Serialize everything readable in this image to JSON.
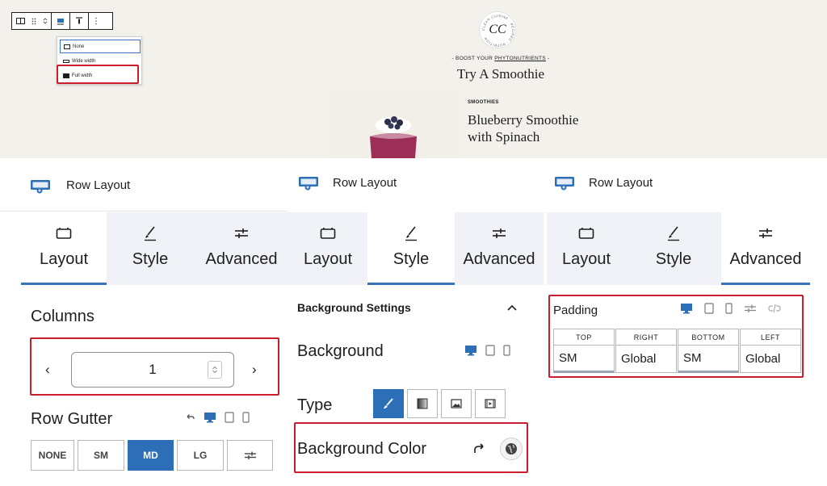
{
  "preview": {
    "align_menu": {
      "items": [
        {
          "label": "None"
        },
        {
          "label": "Wide width"
        },
        {
          "label": "Full width"
        }
      ]
    },
    "logo_text": "CC",
    "logo_ring_text": "CLEAN CUISINE · RECIPES · NUTRITION",
    "boost_prefix": "- BOOST YOUR ",
    "boost_link": "PHYTONUTRIENTS",
    "boost_suffix": " -",
    "section_title": "Try A Smoothie",
    "recipe_category": "SMOOTHIES",
    "recipe_name": "Blueberry Smoothie with Spinach"
  },
  "panels": [
    {
      "block_title": "Row Layout",
      "tabs": [
        {
          "label": "Layout",
          "icon": "layout-icon",
          "active": true
        },
        {
          "label": "Style",
          "icon": "brush-icon",
          "active": false
        },
        {
          "label": "Advanced",
          "icon": "sliders-icon",
          "active": false
        }
      ],
      "columns_label": "Columns",
      "columns_value": "1",
      "prev_glyph": "‹",
      "next_glyph": "›",
      "gutter_label": "Row Gutter",
      "gutter_options": [
        "NONE",
        "SM",
        "MD",
        "LG"
      ],
      "gutter_selected": "MD"
    },
    {
      "block_title": "Row Layout",
      "tabs": [
        {
          "label": "Layout",
          "icon": "layout-icon",
          "active": false
        },
        {
          "label": "Style",
          "icon": "brush-icon",
          "active": true
        },
        {
          "label": "Advanced",
          "icon": "sliders-icon",
          "active": false
        }
      ],
      "bg_settings_label": "Background Settings",
      "background_label": "Background",
      "type_label": "Type",
      "type_options": [
        "color",
        "gradient",
        "image",
        "video"
      ],
      "type_selected": "color",
      "bg_color_label": "Background Color"
    },
    {
      "block_title": "Row Layout",
      "tabs": [
        {
          "label": "Layout",
          "icon": "layout-icon",
          "active": false
        },
        {
          "label": "Style",
          "icon": "brush-icon",
          "active": false
        },
        {
          "label": "Advanced",
          "icon": "sliders-icon",
          "active": true
        }
      ],
      "padding_label": "Padding",
      "padding": [
        {
          "side": "TOP",
          "value": "SM"
        },
        {
          "side": "RIGHT",
          "value": "Global"
        },
        {
          "side": "BOTTOM",
          "value": "SM"
        },
        {
          "side": "LEFT",
          "value": "Global"
        }
      ]
    }
  ],
  "colors": {
    "accent": "#2d6fb7",
    "highlight": "#c81e2f",
    "tab_bg": "#f0f2f7",
    "preview_bg": "#f3f1ec"
  }
}
